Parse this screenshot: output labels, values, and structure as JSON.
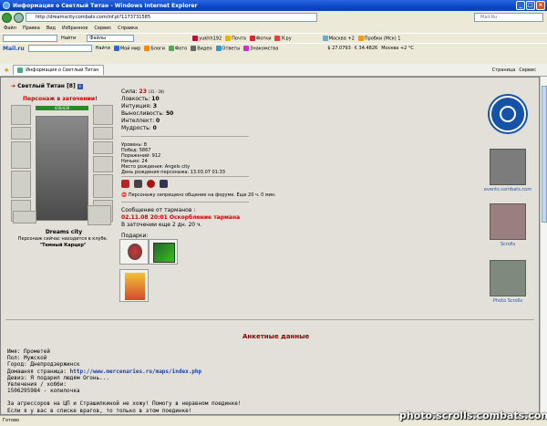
{
  "window": {
    "title": "Информация о Светлый Титан - Windows Internet Explorer",
    "url": "http://dreamscity.combats.com/inf.pl?1173731585",
    "search_placeholder": "Mail.Ru"
  },
  "menu": [
    "Файл",
    "Правка",
    "Вид",
    "Избранное",
    "Сервис",
    "Справка"
  ],
  "toolbar1": {
    "find": "Найти",
    "files": "Файлы",
    "user": "yukhh192",
    "mail": "Почта",
    "photos": "Фотки",
    "ya": "Я.ру",
    "moscow": "Москва +2",
    "traffic": "Пробки (Мск) 1"
  },
  "toolbar2": {
    "brand": "Mail.ru",
    "find": "Найти",
    "world": "Мой мир",
    "blogs": "Блоги",
    "photo": "Фото",
    "video": "Видео",
    "answers": "Ответы",
    "dating": "Знакомства",
    "usd": "$ 27.0793",
    "eur": "€ 34.4826",
    "weather": "Москва +2 °C"
  },
  "tab": {
    "label": "Информация о Светлый Титан"
  },
  "tab_tools": {
    "page": "Страница",
    "service": "Сервис"
  },
  "character": {
    "name": "Светлый Титан",
    "level": "[8]",
    "jail_banner": "Персонаж в заточении!",
    "hp": "430/430",
    "city": "Dreams city",
    "location_text": "Персонаж сейчас находится в клубе.",
    "room": "\"Темный Карцер\""
  },
  "stats": [
    {
      "label": "Сила:",
      "value": "23",
      "extra": "(31 - 28)",
      "red": true
    },
    {
      "label": "Ловкость:",
      "value": "10"
    },
    {
      "label": "Интуиция:",
      "value": "3"
    },
    {
      "label": "Выносливость:",
      "value": "50"
    },
    {
      "label": "Интеллект:",
      "value": "0"
    },
    {
      "label": "Мудрость:",
      "value": "0"
    }
  ],
  "info": [
    "Уровень: 8",
    "Побед: 5867",
    "Поражений: 912",
    "Ничьих: 24",
    "Место рождения: Angels city",
    "День рождения персонажа: 13.03.07 01:33"
  ],
  "forum_ban": "Персонажу запрещено общение на форуме. Еще 20 ч. 0 мин.",
  "tarmans": {
    "header": "Сообщение от тарманов :",
    "message": "02.11.08 20:01 Оскорбление тармана",
    "remaining": "В заточении еще 2 дн. 20 ч."
  },
  "gifts_label": "Подарки:",
  "sidebar": {
    "events": "events.combats.com",
    "scrolls": "Scrolls",
    "photo_scrolls": "Photo Scrolls"
  },
  "anketa": {
    "title": "Анкетные данные",
    "name": "Имя: Прометей",
    "gender": "Пол: Мужской",
    "city": "Город: Днепродзержинск",
    "homepage_label": "Домашняя страница:",
    "homepage": "http://www.mercenaries.ru/maps/index.php",
    "motto": "Девиз: Я подарил людям Огонь...",
    "hobby": "Увлечения / хобби:",
    "line1": "1506295984 - копилочка",
    "line2": "За агрессоров на ЦП и Страшилкиной не хожу! Помогу в неравном поединке!",
    "line3": "Если я у вас в списке врагов, то только в этом поединке!"
  },
  "status": "Готово",
  "watermark": "photo.scrolls.combats.com"
}
